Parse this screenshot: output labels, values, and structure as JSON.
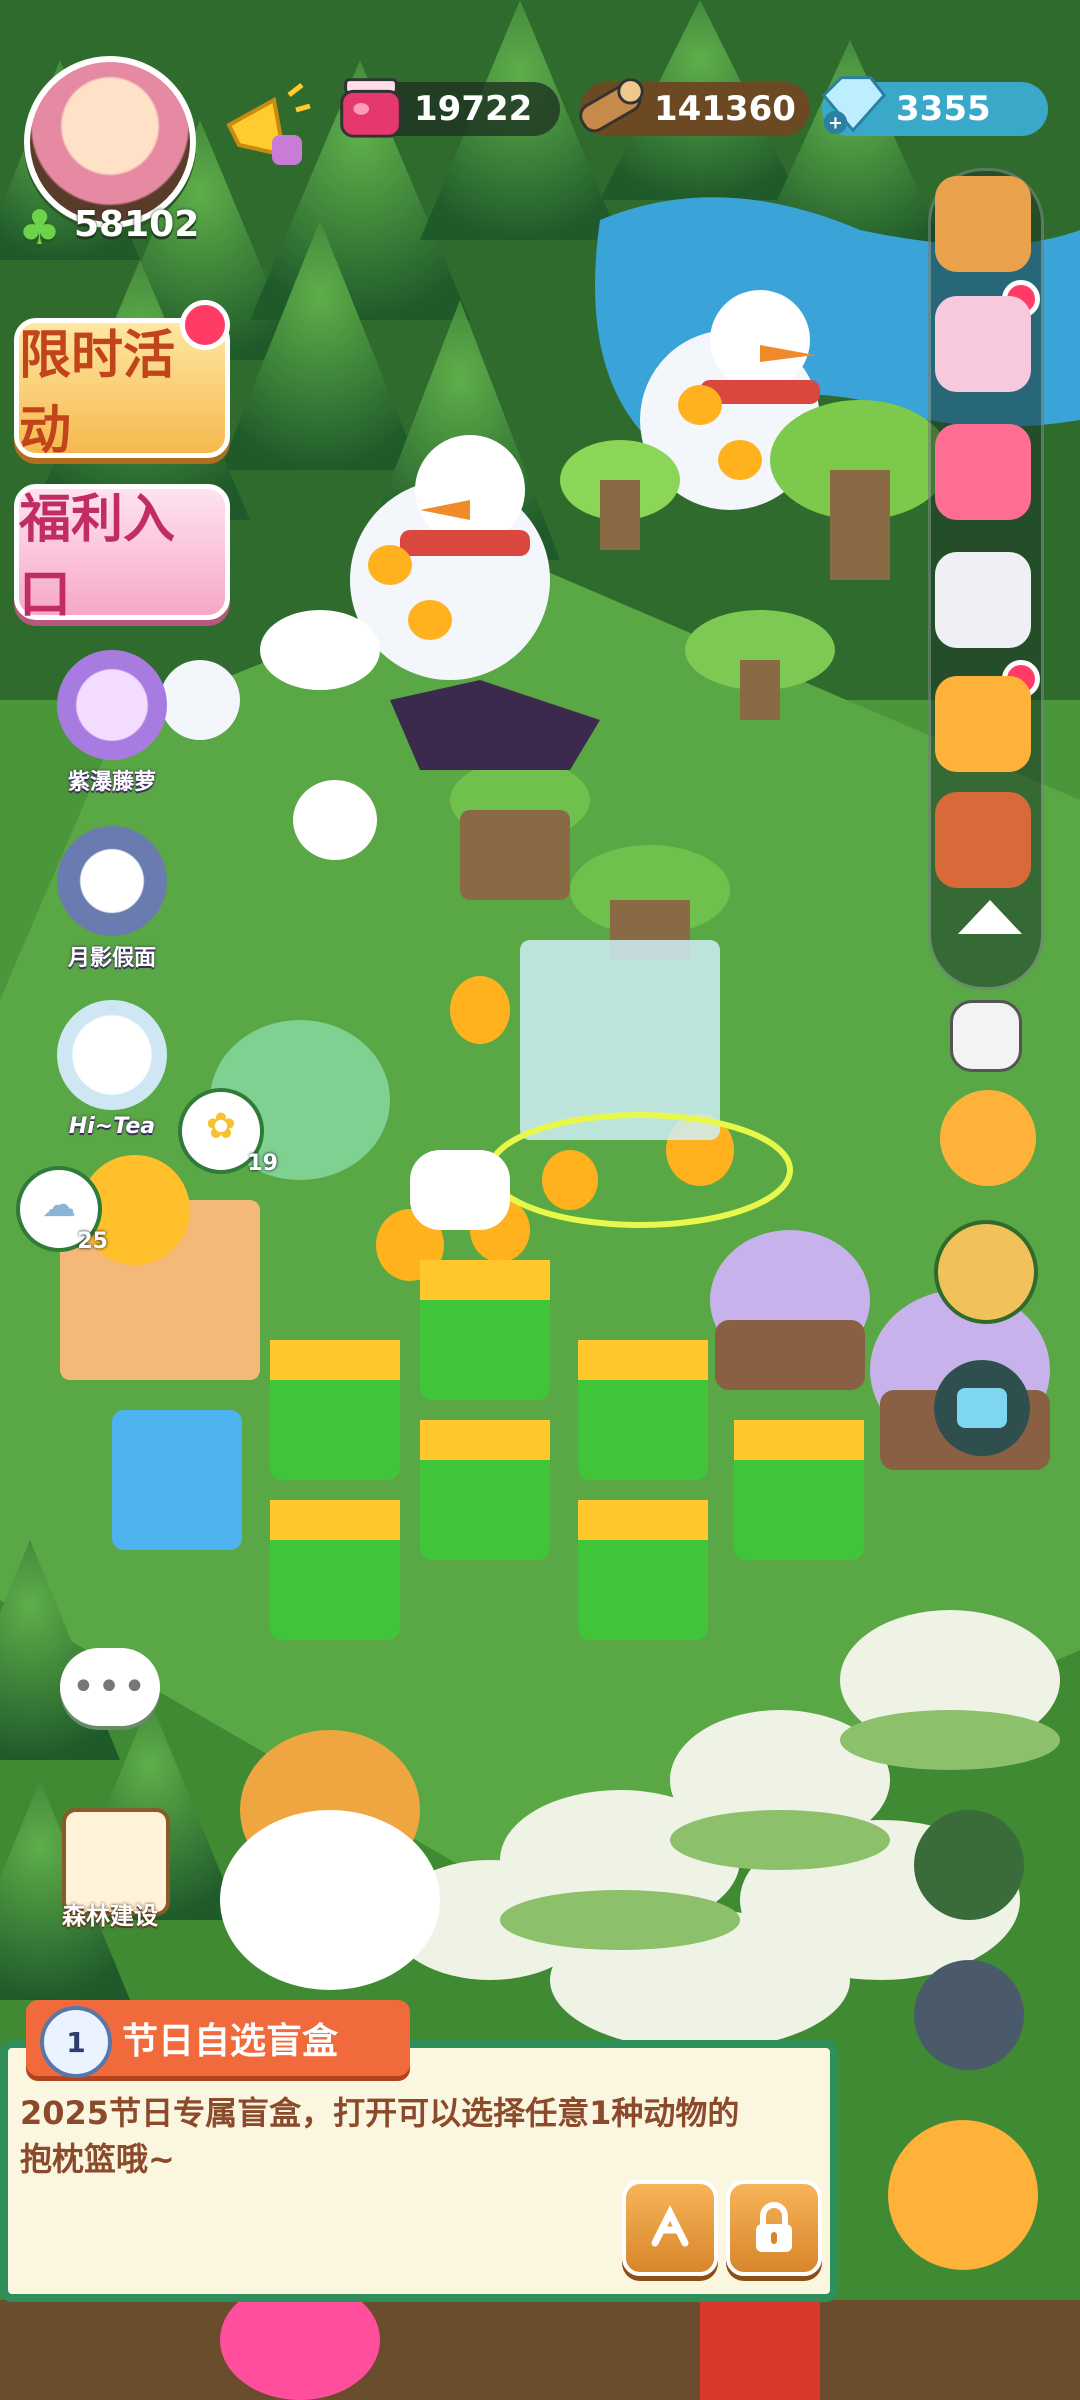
{
  "player": {
    "clover_score": "58102"
  },
  "resources": [
    {
      "name": "jam",
      "icon": "jam-jar-icon",
      "value": "19722"
    },
    {
      "name": "wood",
      "icon": "wood-log-icon",
      "value": "141360"
    },
    {
      "name": "gem",
      "icon": "diamond-icon",
      "value": "3355"
    }
  ],
  "left_menu": {
    "limited_event": "限时活动",
    "welfare": "福利入口",
    "characters": [
      {
        "label": "紫瀑藤萝"
      },
      {
        "label": "月影假面"
      },
      {
        "label": "Hi~Tea"
      }
    ],
    "forest_build": "森林建设"
  },
  "map_badges": {
    "badge_a": "19",
    "badge_b": "25"
  },
  "right_bar": {
    "icons": [
      "shop-stall-icon",
      "pets-icon",
      "cards-icon",
      "remote-icon",
      "chick-icon",
      "book-icon"
    ]
  },
  "right_extras": [
    "camera-icon",
    "phone-chick-icon",
    "golden-pot-icon",
    "tv-icon",
    "hearts-icon",
    "notes-icon",
    "winged-chick-icon"
  ],
  "blind_box": {
    "level": "1",
    "title": "节日自选盲盒",
    "desc": "2025节日专属盲盒，打开可以选择任意1种动物的抱枕篮哦~"
  },
  "colors": {
    "grass": "#4f9a3a",
    "forest": "#2f6b2c",
    "panel_border": "#2f8f5b",
    "title_orange": "#f06a3b",
    "reddot": "#ff3b66"
  }
}
